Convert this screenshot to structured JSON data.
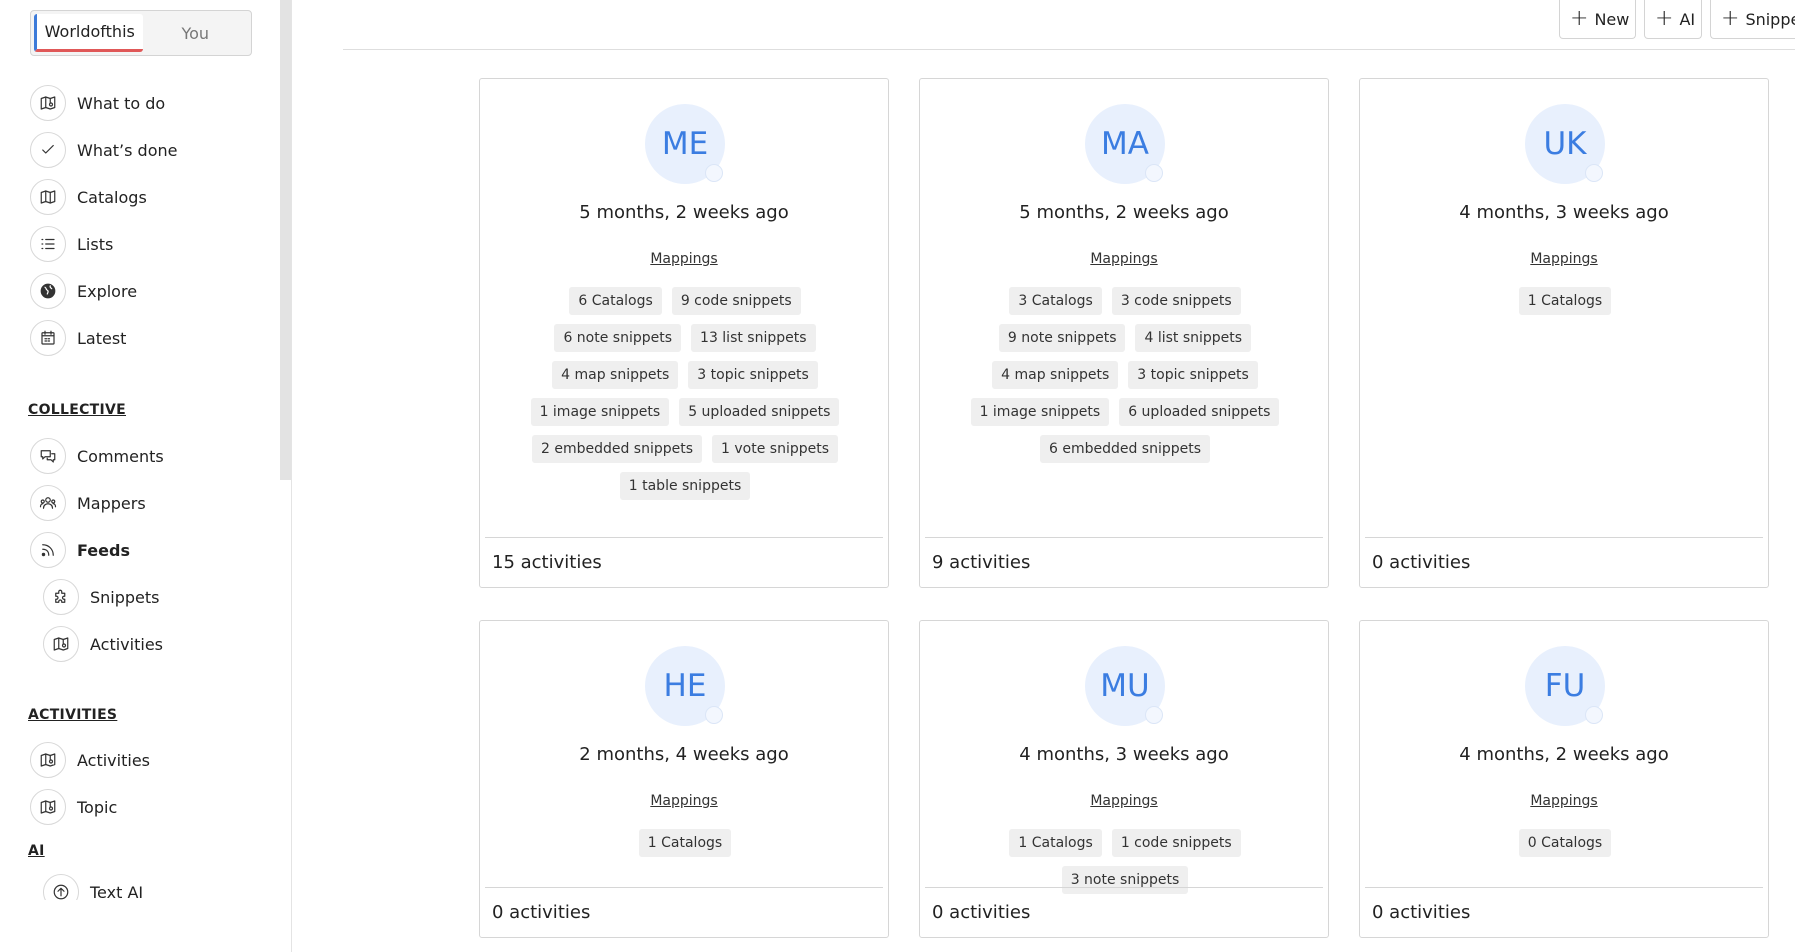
{
  "sidebar": {
    "switch": [
      "Worldofthis",
      "You"
    ],
    "items": [
      {
        "label": "What to do",
        "icon": "map-pin-icon"
      },
      {
        "label": "What’s done",
        "icon": "check-icon"
      },
      {
        "label": "Catalogs",
        "icon": "map-icon"
      },
      {
        "label": "Lists",
        "icon": "list-icon"
      },
      {
        "label": "Explore",
        "icon": "globe-icon"
      },
      {
        "label": "Latest",
        "icon": "calendar-icon"
      }
    ],
    "collective_head": "COLLECTIVE",
    "collective": [
      {
        "label": "Comments",
        "icon": "comments-icon"
      },
      {
        "label": "Mappers",
        "icon": "users-icon"
      },
      {
        "label": "Feeds",
        "icon": "rss-icon"
      },
      {
        "label": "Snippets",
        "icon": "puzzle-icon"
      },
      {
        "label": "Activities",
        "icon": "map-pin-icon"
      }
    ],
    "activities_head": "ACTIVITIES",
    "activities": [
      {
        "label": "Activities",
        "icon": "map-pin-icon"
      },
      {
        "label": "Topic",
        "icon": "map-pin-icon"
      }
    ],
    "ai_head": "AI",
    "ai": [
      {
        "label": "Text AI",
        "icon": "upload-icon"
      }
    ]
  },
  "topbar": {
    "new_label": "New",
    "ai_label": "AI",
    "snippet_label": "Snippe"
  },
  "cards": [
    {
      "initials": "ME",
      "time": "5 months, 2 weeks ago",
      "mappings": "Mappings",
      "chips": [
        "6 Catalogs",
        "9 code snippets",
        "6 note snippets",
        "13 list snippets",
        "4 map snippets",
        "3 topic snippets",
        "1 image snippets",
        "5 uploaded snippets",
        "2 embedded snippets",
        "1 vote snippets",
        "1 table snippets"
      ],
      "footer": "15 activities"
    },
    {
      "initials": "MA",
      "time": "5 months, 2 weeks ago",
      "mappings": "Mappings",
      "chips": [
        "3 Catalogs",
        "3 code snippets",
        "9 note snippets",
        "4 list snippets",
        "4 map snippets",
        "3 topic snippets",
        "1 image snippets",
        "6 uploaded snippets",
        "6 embedded snippets"
      ],
      "footer": "9 activities"
    },
    {
      "initials": "UK",
      "time": "4 months, 3 weeks ago",
      "mappings": "Mappings",
      "chips": [
        "1 Catalogs"
      ],
      "footer": "0 activities"
    },
    {
      "initials": "HE",
      "time": "2 months, 4 weeks ago",
      "mappings": "Mappings",
      "chips": [
        "1 Catalogs"
      ],
      "footer": "0 activities"
    },
    {
      "initials": "MU",
      "time": "4 months, 3 weeks ago",
      "mappings": "Mappings",
      "chips": [
        "1 Catalogs",
        "1 code snippets",
        "3 note snippets"
      ],
      "footer": "0 activities"
    },
    {
      "initials": "FU",
      "time": "4 months, 2 weeks ago",
      "mappings": "Mappings",
      "chips": [
        "0 Catalogs"
      ],
      "footer": "0 activities"
    }
  ],
  "colors": {
    "accent": "#3b7de1",
    "avatar_bg": "#e8f0fd",
    "chip_bg": "#efefef"
  }
}
